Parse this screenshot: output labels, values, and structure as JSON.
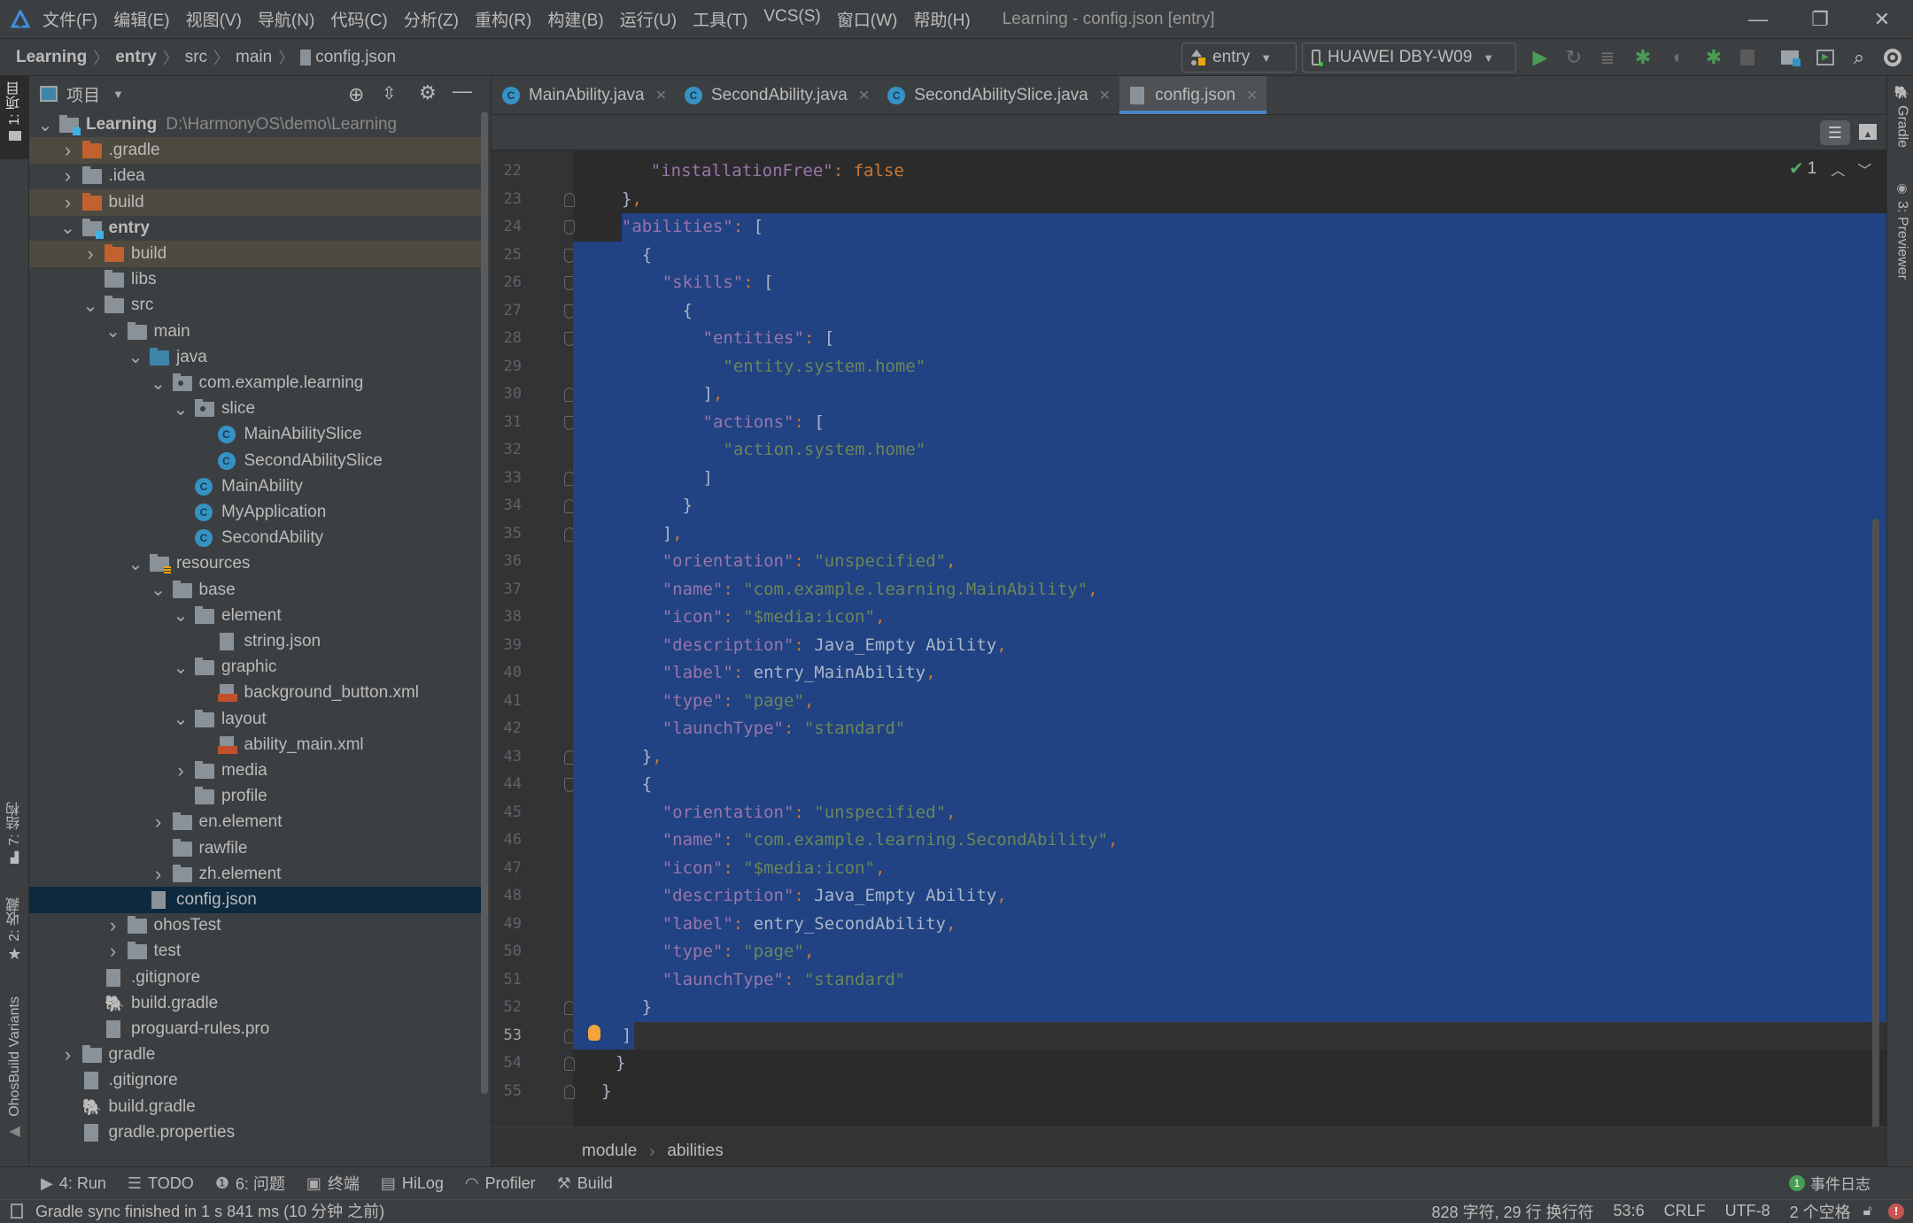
{
  "window": {
    "title": "Learning - config.json [entry]",
    "menu": [
      "文件(F)",
      "编辑(E)",
      "视图(V)",
      "导航(N)",
      "代码(C)",
      "分析(Z)",
      "重构(R)",
      "构建(B)",
      "运行(U)",
      "工具(T)",
      "VCS(S)",
      "窗口(W)",
      "帮助(H)"
    ],
    "controls": {
      "minimize": "—",
      "restore": "❐",
      "close": "✕"
    }
  },
  "navbar": {
    "breadcrumb": [
      "Learning",
      "entry",
      "src",
      "main",
      "config.json"
    ],
    "module_combo": "entry",
    "device_combo": "HUAWEI DBY-W09",
    "icons": [
      "run-icon",
      "rerun-icon",
      "apply-changes-icon",
      "debug-icon",
      "profile-icon",
      "attach-debugger-icon",
      "stop-icon",
      "project-structure-icon",
      "terminal-icon",
      "search-icon",
      "account-icon"
    ]
  },
  "left_strip": {
    "tabs": [
      "1: 项目",
      "7: 结构",
      "2: 收藏",
      "OhosBuild Variants"
    ]
  },
  "right_strip": {
    "tabs": [
      "Gradle",
      "3: Previewer"
    ]
  },
  "project_panel": {
    "title": "项目",
    "tree": [
      {
        "label": "Learning",
        "hint": "D:\\HarmonyOS\\demo\\Learning",
        "depth": 0,
        "chev": "down",
        "icon": "module",
        "bold": true
      },
      {
        "label": ".gradle",
        "depth": 1,
        "chev": "right",
        "icon": "folder-orange",
        "excluded": true
      },
      {
        "label": ".idea",
        "depth": 1,
        "chev": "right",
        "icon": "folder"
      },
      {
        "label": "build",
        "depth": 1,
        "chev": "right",
        "icon": "folder-orange",
        "excluded": true
      },
      {
        "label": "entry",
        "depth": 1,
        "chev": "down",
        "icon": "module",
        "bold": true
      },
      {
        "label": "build",
        "depth": 2,
        "chev": "right",
        "icon": "folder-orange",
        "excluded": true
      },
      {
        "label": "libs",
        "depth": 2,
        "chev": "",
        "icon": "folder"
      },
      {
        "label": "src",
        "depth": 2,
        "chev": "down",
        "icon": "folder"
      },
      {
        "label": "main",
        "depth": 3,
        "chev": "down",
        "icon": "folder"
      },
      {
        "label": "java",
        "depth": 4,
        "chev": "down",
        "icon": "folder-blue"
      },
      {
        "label": "com.example.learning",
        "depth": 5,
        "chev": "down",
        "icon": "package"
      },
      {
        "label": "slice",
        "depth": 6,
        "chev": "down",
        "icon": "package"
      },
      {
        "label": "MainAbilitySlice",
        "depth": 7,
        "chev": "",
        "icon": "class"
      },
      {
        "label": "SecondAbilitySlice",
        "depth": 7,
        "chev": "",
        "icon": "class"
      },
      {
        "label": "MainAbility",
        "depth": 6,
        "chev": "",
        "icon": "class"
      },
      {
        "label": "MyApplication",
        "depth": 6,
        "chev": "",
        "icon": "class"
      },
      {
        "label": "SecondAbility",
        "depth": 6,
        "chev": "",
        "icon": "class"
      },
      {
        "label": "resources",
        "depth": 4,
        "chev": "down",
        "icon": "resources"
      },
      {
        "label": "base",
        "depth": 5,
        "chev": "down",
        "icon": "folder"
      },
      {
        "label": "element",
        "depth": 6,
        "chev": "down",
        "icon": "folder"
      },
      {
        "label": "string.json",
        "depth": 7,
        "chev": "",
        "icon": "json"
      },
      {
        "label": "graphic",
        "depth": 6,
        "chev": "down",
        "icon": "folder"
      },
      {
        "label": "background_button.xml",
        "depth": 7,
        "chev": "",
        "icon": "xml"
      },
      {
        "label": "layout",
        "depth": 6,
        "chev": "down",
        "icon": "folder"
      },
      {
        "label": "ability_main.xml",
        "depth": 7,
        "chev": "",
        "icon": "xml"
      },
      {
        "label": "media",
        "depth": 6,
        "chev": "right",
        "icon": "folder"
      },
      {
        "label": "profile",
        "depth": 6,
        "chev": "",
        "icon": "folder"
      },
      {
        "label": "en.element",
        "depth": 5,
        "chev": "right",
        "icon": "folder"
      },
      {
        "label": "rawfile",
        "depth": 5,
        "chev": "",
        "icon": "folder"
      },
      {
        "label": "zh.element",
        "depth": 5,
        "chev": "right",
        "icon": "folder"
      },
      {
        "label": "config.json",
        "depth": 4,
        "chev": "",
        "icon": "json",
        "selected": true
      },
      {
        "label": "ohosTest",
        "depth": 3,
        "chev": "right",
        "icon": "folder"
      },
      {
        "label": "test",
        "depth": 3,
        "chev": "right",
        "icon": "folder"
      },
      {
        "label": ".gitignore",
        "depth": 2,
        "chev": "",
        "icon": "gitignore"
      },
      {
        "label": "build.gradle",
        "depth": 2,
        "chev": "",
        "icon": "gradle"
      },
      {
        "label": "proguard-rules.pro",
        "depth": 2,
        "chev": "",
        "icon": "text"
      },
      {
        "label": "gradle",
        "depth": 1,
        "chev": "right",
        "icon": "folder"
      },
      {
        "label": ".gitignore",
        "depth": 1,
        "chev": "",
        "icon": "gitignore"
      },
      {
        "label": "build.gradle",
        "depth": 1,
        "chev": "",
        "icon": "gradle"
      },
      {
        "label": "gradle.properties",
        "depth": 1,
        "chev": "",
        "icon": "properties"
      }
    ]
  },
  "editor": {
    "tabs": [
      {
        "label": "MainAbility.java",
        "icon": "class"
      },
      {
        "label": "SecondAbility.java",
        "icon": "class"
      },
      {
        "label": "SecondAbilitySlice.java",
        "icon": "class"
      },
      {
        "label": "config.json",
        "icon": "json",
        "active": true
      }
    ],
    "inspection_count": "1",
    "current_line": 53,
    "lines": [
      {
        "n": 22,
        "indent": 2,
        "tokens": [
          [
            "k",
            "\"installationFree\""
          ],
          [
            "p",
            ": "
          ],
          [
            "f",
            "false"
          ]
        ]
      },
      {
        "n": 23,
        "indent": 1,
        "tokens": [
          [
            "b",
            "}"
          ],
          [
            "p",
            ","
          ]
        ]
      },
      {
        "n": 24,
        "indent": 1,
        "tokens": [
          [
            "k",
            "\"abilities\""
          ],
          [
            "p",
            ": "
          ],
          [
            "b",
            "["
          ]
        ]
      },
      {
        "n": 25,
        "indent": 2,
        "tokens": [
          [
            "b",
            "{"
          ]
        ]
      },
      {
        "n": 26,
        "indent": 3,
        "tokens": [
          [
            "k",
            "\"skills\""
          ],
          [
            "p",
            ": "
          ],
          [
            "b",
            "["
          ]
        ]
      },
      {
        "n": 27,
        "indent": 4,
        "tokens": [
          [
            "b",
            "{"
          ]
        ]
      },
      {
        "n": 28,
        "indent": 5,
        "tokens": [
          [
            "k",
            "\"entities\""
          ],
          [
            "p",
            ": "
          ],
          [
            "b",
            "["
          ]
        ]
      },
      {
        "n": 29,
        "indent": 6,
        "tokens": [
          [
            "s",
            "\"entity.system.home\""
          ]
        ]
      },
      {
        "n": 30,
        "indent": 5,
        "tokens": [
          [
            "b",
            "]"
          ],
          [
            "p",
            ","
          ]
        ]
      },
      {
        "n": 31,
        "indent": 5,
        "tokens": [
          [
            "k",
            "\"actions\""
          ],
          [
            "p",
            ": "
          ],
          [
            "b",
            "["
          ]
        ]
      },
      {
        "n": 32,
        "indent": 6,
        "tokens": [
          [
            "s",
            "\"action.system.home\""
          ]
        ]
      },
      {
        "n": 33,
        "indent": 5,
        "tokens": [
          [
            "b",
            "]"
          ]
        ]
      },
      {
        "n": 34,
        "indent": 4,
        "tokens": [
          [
            "b",
            "}"
          ]
        ]
      },
      {
        "n": 35,
        "indent": 3,
        "tokens": [
          [
            "b",
            "]"
          ],
          [
            "p",
            ","
          ]
        ]
      },
      {
        "n": 36,
        "indent": 3,
        "tokens": [
          [
            "k",
            "\"orientation\""
          ],
          [
            "p",
            ": "
          ],
          [
            "s",
            "\"unspecified\""
          ],
          [
            "p",
            ","
          ]
        ]
      },
      {
        "n": 37,
        "indent": 3,
        "tokens": [
          [
            "k",
            "\"name\""
          ],
          [
            "p",
            ": "
          ],
          [
            "s",
            "\"com.example.learning.MainAbility\""
          ],
          [
            "p",
            ","
          ]
        ]
      },
      {
        "n": 38,
        "indent": 3,
        "tokens": [
          [
            "k",
            "\"icon\""
          ],
          [
            "p",
            ": "
          ],
          [
            "s",
            "\"$media:icon\""
          ],
          [
            "p",
            ","
          ]
        ]
      },
      {
        "n": 39,
        "indent": 3,
        "tokens": [
          [
            "k",
            "\"description\""
          ],
          [
            "p",
            ": "
          ],
          [
            "b",
            "Java_Empty Ability"
          ],
          [
            "p",
            ","
          ]
        ]
      },
      {
        "n": 40,
        "indent": 3,
        "tokens": [
          [
            "k",
            "\"label\""
          ],
          [
            "p",
            ": "
          ],
          [
            "b",
            "entry_MainAbility"
          ],
          [
            "p",
            ","
          ]
        ]
      },
      {
        "n": 41,
        "indent": 3,
        "tokens": [
          [
            "k",
            "\"type\""
          ],
          [
            "p",
            ": "
          ],
          [
            "s",
            "\"page\""
          ],
          [
            "p",
            ","
          ]
        ]
      },
      {
        "n": 42,
        "indent": 3,
        "tokens": [
          [
            "k",
            "\"launchType\""
          ],
          [
            "p",
            ": "
          ],
          [
            "s",
            "\"standard\""
          ]
        ]
      },
      {
        "n": 43,
        "indent": 2,
        "tokens": [
          [
            "b",
            "}"
          ],
          [
            "p",
            ","
          ]
        ]
      },
      {
        "n": 44,
        "indent": 2,
        "tokens": [
          [
            "b",
            "{"
          ]
        ]
      },
      {
        "n": 45,
        "indent": 3,
        "tokens": [
          [
            "k",
            "\"orientation\""
          ],
          [
            "p",
            ": "
          ],
          [
            "s",
            "\"unspecified\""
          ],
          [
            "p",
            ","
          ]
        ]
      },
      {
        "n": 46,
        "indent": 3,
        "tokens": [
          [
            "k",
            "\"name\""
          ],
          [
            "p",
            ": "
          ],
          [
            "s",
            "\"com.example.learning.SecondAbility\""
          ],
          [
            "p",
            ","
          ]
        ]
      },
      {
        "n": 47,
        "indent": 3,
        "tokens": [
          [
            "k",
            "\"icon\""
          ],
          [
            "p",
            ": "
          ],
          [
            "s",
            "\"$media:icon\""
          ],
          [
            "p",
            ","
          ]
        ]
      },
      {
        "n": 48,
        "indent": 3,
        "tokens": [
          [
            "k",
            "\"description\""
          ],
          [
            "p",
            ": "
          ],
          [
            "b",
            "Java_Empty Ability"
          ],
          [
            "p",
            ","
          ]
        ]
      },
      {
        "n": 49,
        "indent": 3,
        "tokens": [
          [
            "k",
            "\"label\""
          ],
          [
            "p",
            ": "
          ],
          [
            "b",
            "entry_SecondAbility"
          ],
          [
            "p",
            ","
          ]
        ]
      },
      {
        "n": 50,
        "indent": 3,
        "tokens": [
          [
            "k",
            "\"type\""
          ],
          [
            "p",
            ": "
          ],
          [
            "s",
            "\"page\""
          ],
          [
            "p",
            ","
          ]
        ]
      },
      {
        "n": 51,
        "indent": 3,
        "tokens": [
          [
            "k",
            "\"launchType\""
          ],
          [
            "p",
            ": "
          ],
          [
            "s",
            "\"standard\""
          ]
        ]
      },
      {
        "n": 52,
        "indent": 2,
        "tokens": [
          [
            "b",
            "}"
          ]
        ]
      },
      {
        "n": 53,
        "indent": 1,
        "tokens": [
          [
            "b",
            "]"
          ]
        ]
      },
      {
        "n": 54,
        "indent": 0.5,
        "tokens": [
          [
            "b",
            "}"
          ]
        ]
      },
      {
        "n": 55,
        "indent": 0,
        "tokens": [
          [
            "b",
            "}"
          ]
        ]
      }
    ],
    "breadcrumb": [
      "module",
      "abilities"
    ]
  },
  "bottom_tools": [
    {
      "label": "4: Run",
      "icon": "run-icon"
    },
    {
      "label": "TODO",
      "icon": "list-icon"
    },
    {
      "label": "6: 问题",
      "icon": "problems-icon"
    },
    {
      "label": "终端",
      "icon": "terminal-icon"
    },
    {
      "label": "HiLog",
      "icon": "hilog-icon"
    },
    {
      "label": "Profiler",
      "icon": "profiler-icon"
    },
    {
      "label": "Build",
      "icon": "hammer-icon"
    }
  ],
  "event_log": {
    "count": "1",
    "label": "事件日志"
  },
  "status": {
    "message": "Gradle sync finished in 1 s 841 ms (10 分钟 之前)",
    "selection": "828 字符, 29 行 换行符",
    "position": "53:6",
    "line_sep": "CRLF",
    "encoding": "UTF-8",
    "indent": "2 个空格"
  },
  "colors": {
    "selection": "#214283",
    "accent": "#4a88c7",
    "keyword": "#9876aa",
    "string": "#6a8759",
    "punct": "#cc7832"
  }
}
